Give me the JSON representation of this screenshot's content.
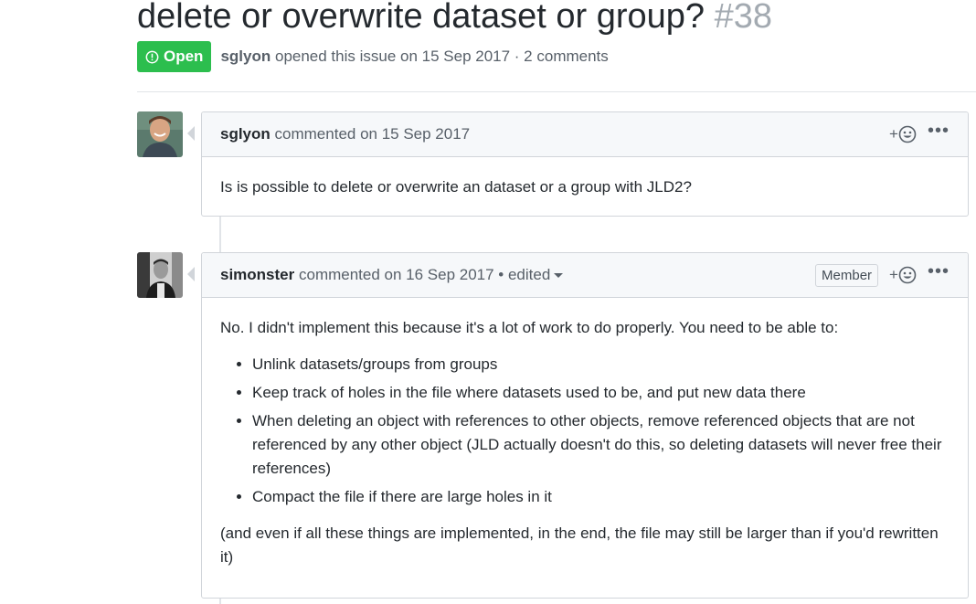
{
  "issue": {
    "title": "delete or overwrite dataset or group?",
    "number": "#38",
    "state": "Open",
    "author": "sglyon",
    "opened_text": "opened this issue on 15 Sep 2017 · 2 comments"
  },
  "comments": [
    {
      "author": "sglyon",
      "meta": "commented on 15 Sep 2017",
      "body": "Is is possible to delete or overwrite an dataset or a group with JLD2?"
    },
    {
      "author": "simonster",
      "meta": "commented on 16 Sep 2017 • edited",
      "role": "Member",
      "intro": "No. I didn't implement this because it's a lot of work to do properly. You need to be able to:",
      "items": [
        "Unlink datasets/groups from groups",
        "Keep track of holes in the file where datasets used to be, and put new data there",
        "When deleting an object with references to other objects, remove referenced objects that are not referenced by any other object (JLD actually doesn't do this, so deleting datasets will never free their references)",
        "Compact the file if there are large holes in it"
      ],
      "outro": "(and even if all these things are implemented, in the end, the file may still be larger than if you'd rewritten it)"
    }
  ],
  "reaction_label": "+",
  "more_label": "•••",
  "colors": {
    "open_green": "#2cbe4e",
    "border": "#d1d5da",
    "header_bg": "#f6f8fa"
  }
}
